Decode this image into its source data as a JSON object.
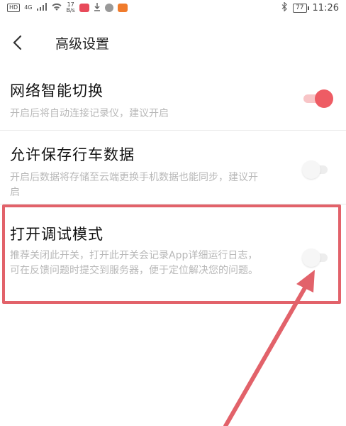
{
  "status_bar": {
    "left_badge": "HD",
    "signal": "4G",
    "speed_value": "17",
    "speed_unit": "B/s",
    "battery": "77",
    "time": "11:26"
  },
  "header": {
    "title": "高级设置"
  },
  "settings": [
    {
      "title": "网络智能切换",
      "desc": "开启后将自动连接记录仪，建议开启",
      "toggle": "on"
    },
    {
      "title": "允许保存行车数据",
      "desc": "开启后数据将存储至云端更换手机数据也能同步，建议开启",
      "toggle": "off"
    },
    {
      "title": "打开调试模式",
      "desc": "推荐关闭此开关，打开此开关会记录App详细运行日志，可在反馈问题时提交到服务器，便于定位解决您的问题。",
      "toggle": "off"
    }
  ],
  "colors": {
    "accent": "#ee5c64",
    "annotation": "#e2626a"
  }
}
